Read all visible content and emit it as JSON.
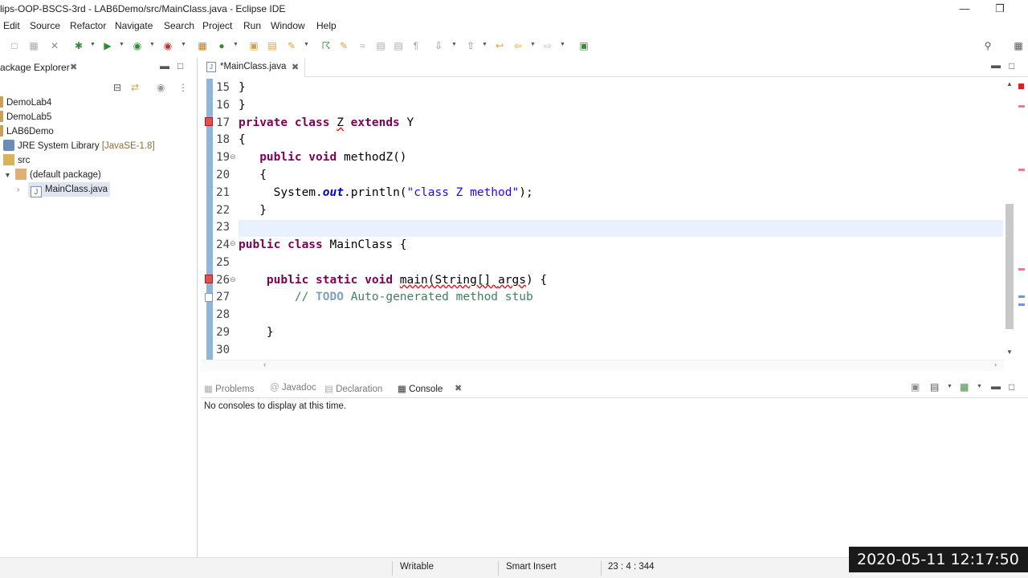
{
  "window": {
    "title": "lips-OOP-BSCS-3rd - LAB6Demo/src/MainClass.java - Eclipse IDE"
  },
  "menu": [
    "Edit",
    "Source",
    "Refactor",
    "Navigate",
    "Search",
    "Project",
    "Run",
    "Window",
    "Help"
  ],
  "package_explorer": {
    "tab_label": "ackage Explorer",
    "items": [
      {
        "label": "DemoLab4"
      },
      {
        "label": "DemoLab5"
      },
      {
        "label": "LAB6Demo"
      },
      {
        "label": "JRE System Library",
        "suffix": "[JavaSE-1.8]"
      },
      {
        "label": "src"
      },
      {
        "label": "(default package)"
      },
      {
        "label": "MainClass.java"
      }
    ]
  },
  "editor": {
    "tab_label": "*MainClass.java",
    "line_numbers": [
      "15",
      "16",
      "17",
      "18",
      "19",
      "20",
      "21",
      "22",
      "23",
      "24",
      "25",
      "26",
      "27",
      "28",
      "29",
      "30"
    ],
    "code": {
      "l15": "}",
      "l16": "}",
      "l17_kw1": "private class ",
      "l17_z": "Z",
      "l17_kw2": " extends ",
      "l17_y": "Y",
      "l18": "{",
      "l19_kw": "public void ",
      "l19_rest": "methodZ()",
      "l20": "{",
      "l21_a": "System.",
      "l21_out": "out",
      "l21_b": ".println(",
      "l21_str": "\"class Z method\"",
      "l21_c": ");",
      "l22": "}",
      "l24_kw": "public class ",
      "l24_rest": "MainClass {",
      "l26_kw": "public static void ",
      "l26_main": "main",
      "l26_rest1": "(String[] ",
      "l26_args": "args",
      "l26_rest2": ") {",
      "l27_cm1": "// ",
      "l27_todo": "TODO",
      "l27_cm2": " Auto-generated method stub",
      "l29": "}"
    }
  },
  "bottom_panel": {
    "tabs": [
      "Problems",
      "Javadoc",
      "Declaration",
      "Console"
    ],
    "active_tab": "Console",
    "message": "No consoles to display at this time."
  },
  "status_bar": {
    "writable": "Writable",
    "insert_mode": "Smart Insert",
    "position": "23 : 4 : 344"
  },
  "overlay_timestamp": "2020-05-11 12:17:50"
}
